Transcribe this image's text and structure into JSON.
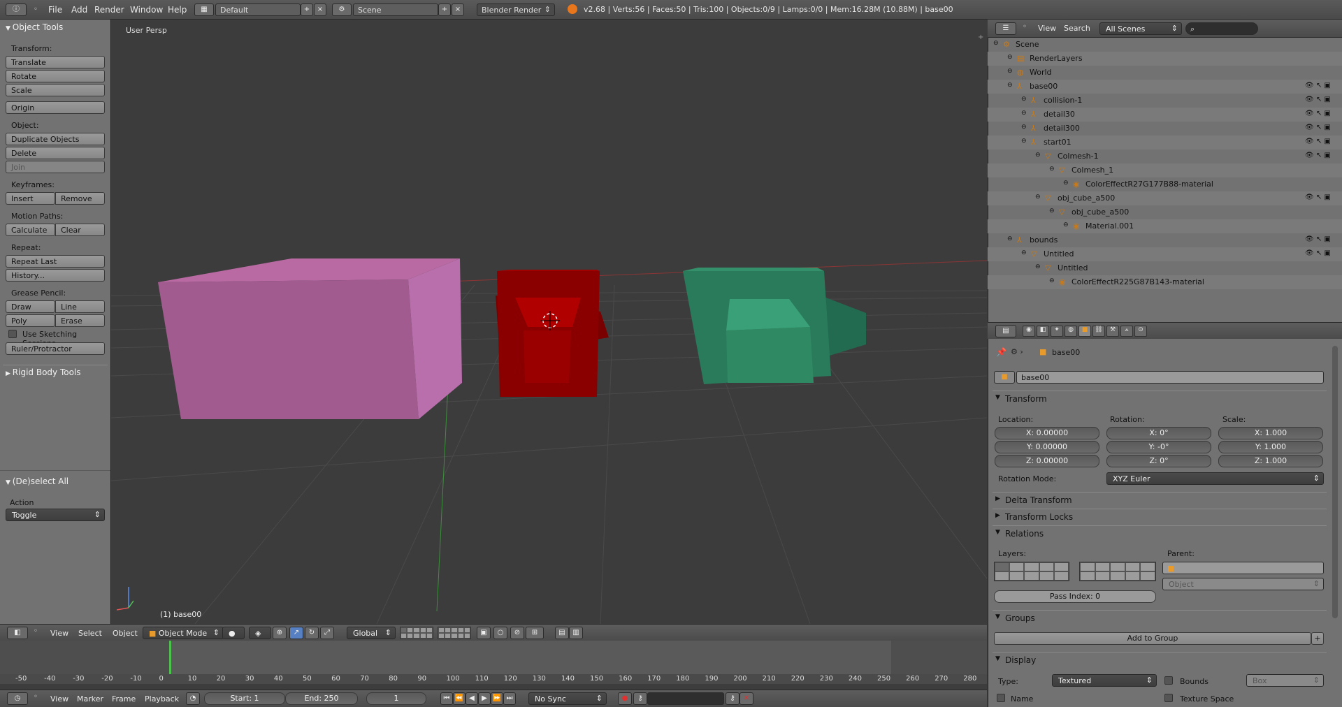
{
  "topbar": {
    "menus": [
      "File",
      "Add",
      "Render",
      "Window",
      "Help"
    ],
    "screen_layout": "Default",
    "scene": "Scene",
    "render_engine": "Blender Render",
    "stats": "v2.68 | Verts:56 | Faces:50 | Tris:100 | Objects:0/9 | Lamps:0/0 | Mem:16.28M (10.88M) | base00"
  },
  "toolshelf": {
    "title": "Object Tools",
    "transform_label": "Transform:",
    "translate": "Translate",
    "rotate": "Rotate",
    "scale": "Scale",
    "origin": "Origin",
    "object_label": "Object:",
    "duplicate": "Duplicate Objects",
    "delete": "Delete",
    "join": "Join",
    "keyframes_label": "Keyframes:",
    "insert": "Insert",
    "remove": "Remove",
    "motion_label": "Motion Paths:",
    "calculate": "Calculate",
    "clear": "Clear",
    "repeat_label": "Repeat:",
    "repeat_last": "Repeat Last",
    "history": "History...",
    "grease_label": "Grease Pencil:",
    "draw": "Draw",
    "line": "Line",
    "poly": "Poly",
    "erase": "Erase",
    "sketching": "Use Sketching Sessions",
    "ruler": "Ruler/Protractor",
    "rigid": "Rigid Body Tools",
    "deselect_title": "(De)select All",
    "action_label": "Action",
    "action_value": "Toggle"
  },
  "viewport": {
    "view_label": "User Persp",
    "object_label": "(1) base00"
  },
  "viewheader": {
    "menus": [
      "View",
      "Select",
      "Object"
    ],
    "mode": "Object Mode",
    "orientation": "Global"
  },
  "timeline": {
    "ticks": [
      "-50",
      "-40",
      "-30",
      "-20",
      "-10",
      "0",
      "10",
      "20",
      "30",
      "40",
      "50",
      "60",
      "70",
      "80",
      "90",
      "100",
      "110",
      "120",
      "130",
      "140",
      "150",
      "160",
      "170",
      "180",
      "190",
      "200",
      "210",
      "220",
      "230",
      "240",
      "250",
      "260",
      "270",
      "280"
    ],
    "menus": [
      "View",
      "Marker",
      "Frame",
      "Playback"
    ],
    "start": "Start: 1",
    "end": "End: 250",
    "current": "1",
    "sync": "No Sync"
  },
  "outliner": {
    "menus": [
      "View",
      "Search"
    ],
    "filter": "All Scenes",
    "items": [
      {
        "label": "Scene",
        "indent": 0
      },
      {
        "label": "RenderLayers",
        "indent": 1
      },
      {
        "label": "World",
        "indent": 1
      },
      {
        "label": "base00",
        "indent": 1
      },
      {
        "label": "collision-1",
        "indent": 2
      },
      {
        "label": "detail30",
        "indent": 2
      },
      {
        "label": "detail300",
        "indent": 2
      },
      {
        "label": "start01",
        "indent": 2
      },
      {
        "label": "Colmesh-1",
        "indent": 3
      },
      {
        "label": "Colmesh_1",
        "indent": 4
      },
      {
        "label": "ColorEffectR27G177B88-material",
        "indent": 5
      },
      {
        "label": "obj_cube_a500",
        "indent": 3
      },
      {
        "label": "obj_cube_a500",
        "indent": 4
      },
      {
        "label": "Material.001",
        "indent": 5
      },
      {
        "label": "bounds",
        "indent": 1
      },
      {
        "label": "Untitled",
        "indent": 2
      },
      {
        "label": "Untitled",
        "indent": 3
      },
      {
        "label": "ColorEffectR225G87B143-material",
        "indent": 4
      }
    ]
  },
  "properties": {
    "breadcrumb": "base00",
    "object_name": "base00",
    "transform": "Transform",
    "location_label": "Location:",
    "rotation_label": "Rotation:",
    "scale_label": "Scale:",
    "loc_x": "X: 0.00000",
    "loc_y": "Y: 0.00000",
    "loc_z": "Z: 0.00000",
    "rot_x": "X: 0°",
    "rot_y": "Y: -0°",
    "rot_z": "Z: 0°",
    "scale_x": "X: 1.000",
    "scale_y": "Y: 1.000",
    "scale_z": "Z: 1.000",
    "rotation_mode_label": "Rotation Mode:",
    "rotation_mode": "XYZ Euler",
    "delta": "Delta Transform",
    "locks": "Transform Locks",
    "relations": "Relations",
    "layers_label": "Layers:",
    "parent_label": "Parent:",
    "parent_type": "Object",
    "pass_index": "Pass Index: 0",
    "groups": "Groups",
    "add_group": "Add to Group",
    "display": "Display",
    "type_label": "Type:",
    "type_value": "Textured",
    "bounds": "Bounds",
    "bounds_type": "Box",
    "name": "Name",
    "texture_space": "Texture Space"
  },
  "colors": {
    "pink": "#a15b8f",
    "red": "#8a0000",
    "green": "#2a7a5c"
  }
}
